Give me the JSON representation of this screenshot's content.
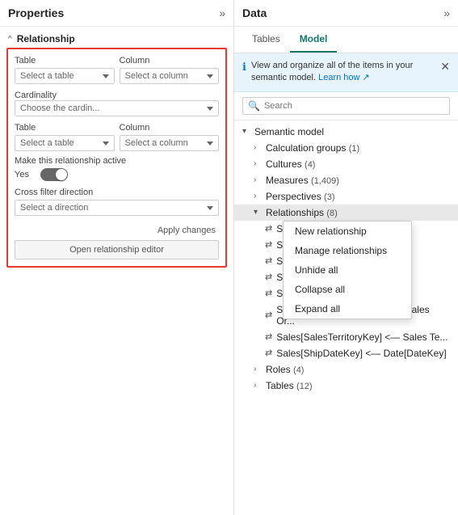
{
  "leftPanel": {
    "title": "Properties",
    "expandIcon": "»",
    "section": {
      "label": "Relationship",
      "collapseIcon": "^"
    },
    "form": {
      "tableLabel1": "Table",
      "columnLabel1": "Column",
      "tableSelect1Placeholder": "Select a table",
      "columnSelect1Placeholder": "Select a column",
      "cardinalityLabel": "Cardinality",
      "cardinalityPlaceholder": "Choose the cardin...",
      "tableLabel2": "Table",
      "columnLabel2": "Column",
      "tableSelect2Placeholder": "Select a table",
      "columnSelect2Placeholder": "Select a column",
      "activeLabel": "Make this relationship active",
      "yesLabel": "Yes",
      "crossFilterLabel": "Cross filter direction",
      "directionPlaceholder": "Select a direction",
      "applyChangesLabel": "Apply changes",
      "openEditorLabel": "Open relationship editor"
    }
  },
  "rightPanel": {
    "title": "Data",
    "expandIcon": "»",
    "tabs": [
      {
        "label": "Tables",
        "active": false
      },
      {
        "label": "Model",
        "active": true
      }
    ],
    "infoBar": {
      "text": "View and organize all of the items in your semantic model.",
      "learnLink": "Learn how",
      "externalIcon": "↗"
    },
    "search": {
      "placeholder": "Search"
    },
    "tree": {
      "rootLabel": "Semantic model",
      "items": [
        {
          "label": "Calculation groups",
          "count": "(1)",
          "expanded": false
        },
        {
          "label": "Cultures",
          "count": "(4)",
          "expanded": false
        },
        {
          "label": "Measures",
          "count": "(1,409)",
          "expanded": false
        },
        {
          "label": "Perspectives",
          "count": "(3)",
          "expanded": false
        },
        {
          "label": "Relationships",
          "count": "(8)",
          "expanded": true
        },
        {
          "label": "Sales[",
          "isChild": true,
          "index": 0
        },
        {
          "label": "Sales[",
          "isChild": true,
          "index": 1
        },
        {
          "label": "Sales[",
          "isChild": true,
          "index": 2
        },
        {
          "label": "Sales[F",
          "isChild": true,
          "index": 3
        },
        {
          "label": "Sales[F",
          "isChild": true,
          "index": 4
        },
        {
          "label": "Sales[SalesOrderLineKey] — Sales Or...",
          "isChild": true,
          "index": 5
        },
        {
          "label": "Sales[SalesTerritoryKey] <— Sales Te...",
          "isChild": true,
          "index": 6
        },
        {
          "label": "Sales[ShipDateKey] <— Date[DateKey]",
          "isChild": true,
          "index": 7
        }
      ],
      "belowRel": [
        {
          "label": "Roles",
          "count": "(4)",
          "expanded": false
        },
        {
          "label": "Tables",
          "count": "(12)",
          "expanded": false
        }
      ]
    },
    "contextMenu": {
      "items": [
        "New relationship",
        "Manage relationships",
        "Unhide all",
        "Collapse all",
        "Expand all"
      ]
    }
  }
}
